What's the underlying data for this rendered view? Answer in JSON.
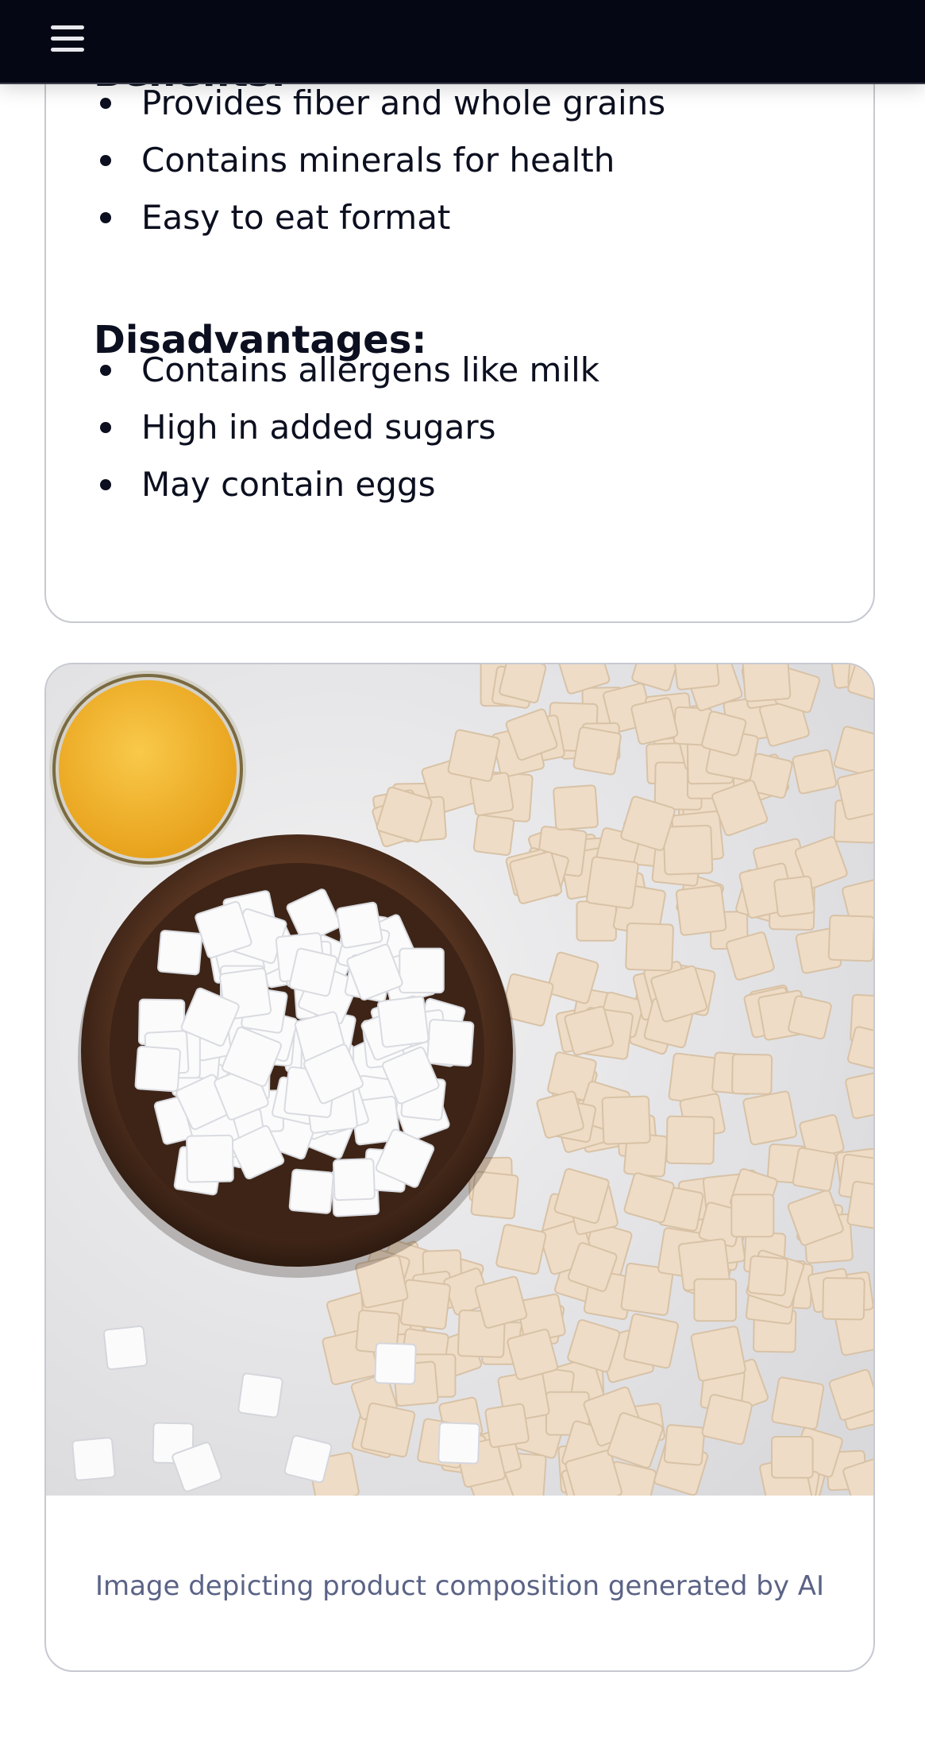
{
  "header": {
    "menu_icon": "hamburger-menu-icon"
  },
  "info_card": {
    "benefits_heading": "Benefits:",
    "benefits": [
      "Provides fiber and whole grains",
      "Contains minerals for health",
      "Easy to eat format"
    ],
    "disadvantages_heading": "Disadvantages:",
    "disadvantages": [
      "Contains allergens like milk",
      "High in added sugars",
      "May contain eggs"
    ]
  },
  "image_card": {
    "caption": "Image depicting product composition generated by AI"
  },
  "colors": {
    "topbar": "#050814",
    "caption": "#5b6386",
    "card_border": "#c7c9d1"
  }
}
